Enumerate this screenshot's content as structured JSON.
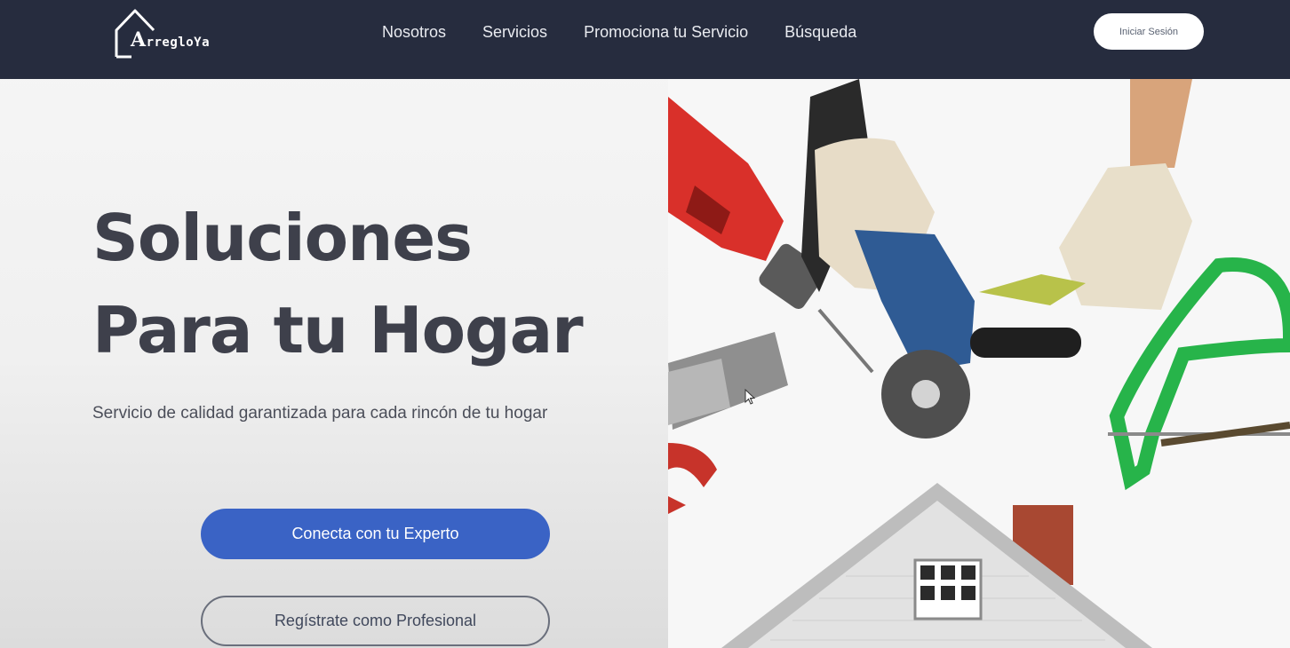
{
  "header": {
    "logo_text_first": "A",
    "logo_text_rest": "rregloYa",
    "nav": [
      {
        "label": "Nosotros"
      },
      {
        "label": "Servicios"
      },
      {
        "label": "Promociona tu Servicio"
      },
      {
        "label": "Búsqueda"
      }
    ],
    "login_label": "Iniciar Sesión"
  },
  "hero": {
    "title_line1": "Soluciones",
    "title_line2": "Para tu Hogar",
    "subtitle": "Servicio de calidad garantizada para cada rincón de tu hogar",
    "primary_button": "Conecta con tu Experto",
    "secondary_button": "Regístrate como Profesional"
  },
  "colors": {
    "nav_bg": "#262c3e",
    "primary": "#3a63c5",
    "title_text": "#3e404b"
  },
  "icons": {
    "logo": "house-outline-icon",
    "cursor": "mouse-pointer-icon"
  }
}
